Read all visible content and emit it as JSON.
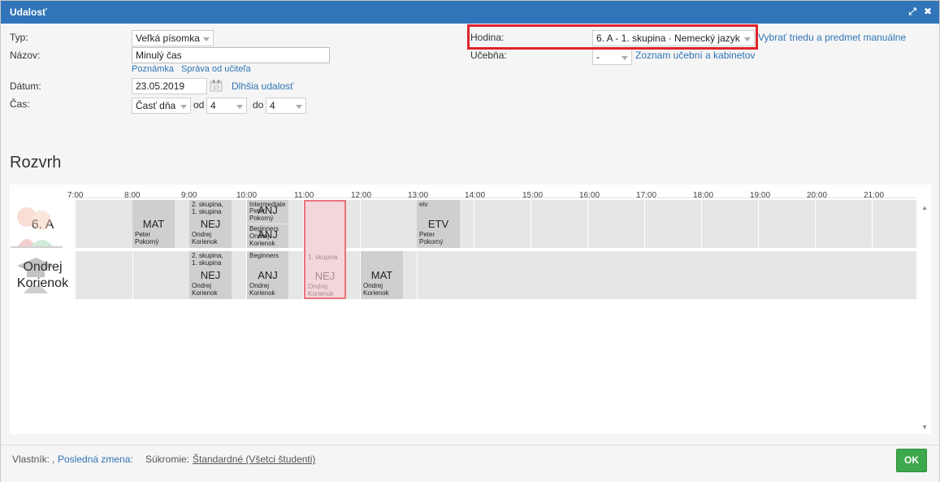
{
  "window": {
    "title": "Udalosť"
  },
  "form": {
    "typ_label": "Typ:",
    "typ_value": "Veľká písomka",
    "nazov_label": "Názov:",
    "nazov_value": "Minulý čas",
    "poznamka_link": "Poznámka",
    "sprava_link": "Správa od učiteľa",
    "datum_label": "Dátum:",
    "datum_value": "23.05.2019",
    "dlhsia_link": "Dlhšia udalosť",
    "cas_label": "Čas:",
    "cas_value": "Časť dňa",
    "od_label": "od",
    "od_value": "4",
    "do_label": "do",
    "do_value": "4",
    "hodina_label": "Hodina:",
    "hodina_value": "6. A - 1. skupina · Nemecký jazyk",
    "vybrat_link": "Vybrať triedu a predmet manuálne",
    "ucebna_label": "Učebňa:",
    "ucebna_value": "-",
    "zoznam_link": "Zoznam učební a kabinetov"
  },
  "schedule": {
    "title": "Rozvrh",
    "hours": [
      "7:00",
      "8:00",
      "9:00",
      "10:00",
      "11:00",
      "12:00",
      "13:00",
      "14:00",
      "15:00",
      "16:00",
      "17:00",
      "18:00",
      "19:00",
      "20:00",
      "21:00"
    ],
    "rows": [
      {
        "label": "6. A"
      },
      {
        "label": "Ondrej Korienok"
      }
    ],
    "cards": {
      "r1_mat": {
        "subject": "MAT",
        "teacher": "Peter\nPokorný",
        "top": ""
      },
      "r1_nej": {
        "subject": "NEJ",
        "teacher": "Ondrej\nKorienok",
        "top": "2. skupina,\n1. skupina"
      },
      "r1_anj_a": {
        "subject": "ANJ",
        "teacher": "Peter\nPokorný",
        "top": "Intermediate"
      },
      "r1_anj_b": {
        "subject": "ANJ",
        "teacher": "Ondrej\nKorienok",
        "top": "Beginners"
      },
      "r1_etv": {
        "subject": "ETV",
        "teacher": "Peter\nPokorný",
        "top": "etv"
      },
      "r2_nej": {
        "subject": "NEJ",
        "teacher": "Ondrej\nKorienok",
        "top": "2. skupina,\n1. skupina"
      },
      "r2_anj": {
        "subject": "ANJ",
        "teacher": "Ondrej\nKorienok",
        "top": "Beginners"
      },
      "r2_sel": {
        "subject": "NEJ",
        "teacher": "Ondrej\nKorienok",
        "top": "1. skupina"
      },
      "r2_mat": {
        "subject": "MAT",
        "teacher": "Ondrej\nKorienok",
        "top": ""
      }
    }
  },
  "footer": {
    "vlastnik_label": "Vlastník:",
    "vlastnik_value": ",",
    "posledna_link": "Posledná zmena:",
    "sukromie_label": "Súkromie:",
    "sukromie_value": "Štandardné (Všetci študenti)",
    "ok_label": "OK"
  },
  "colors": {
    "titlebar": "#3075b9",
    "highlight": "#e0242b",
    "ok": "#3ea84c",
    "link": "#2f74b5"
  }
}
